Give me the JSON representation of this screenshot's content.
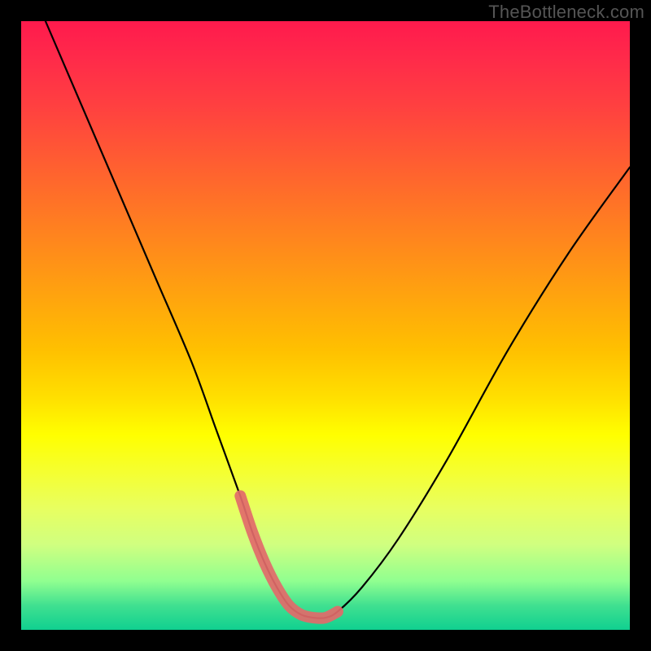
{
  "watermark": "TheBottleneck.com",
  "chart_data": {
    "type": "line",
    "title": "",
    "xlabel": "",
    "ylabel": "",
    "xlim": [
      0,
      100
    ],
    "ylim": [
      0,
      100
    ],
    "series": [
      {
        "name": "bottleneck-curve",
        "x": [
          4,
          10,
          16,
          22,
          28,
          32,
          36,
          38,
          40,
          42,
          44,
          46,
          48,
          50,
          52,
          56,
          62,
          70,
          80,
          90,
          100
        ],
        "values": [
          100,
          86,
          72,
          58,
          44,
          33,
          22,
          16,
          11,
          7,
          4,
          2.5,
          2,
          2,
          3,
          7,
          15,
          28,
          46,
          62,
          76
        ]
      }
    ],
    "highlight": {
      "name": "curve-bottom-highlight",
      "color": "#e26a6a",
      "x": [
        36,
        38,
        40,
        42,
        44,
        46,
        48,
        50,
        52
      ],
      "values": [
        22,
        16,
        11,
        7,
        4,
        2.5,
        2,
        2,
        3
      ]
    },
    "grid": false,
    "legend": false
  }
}
